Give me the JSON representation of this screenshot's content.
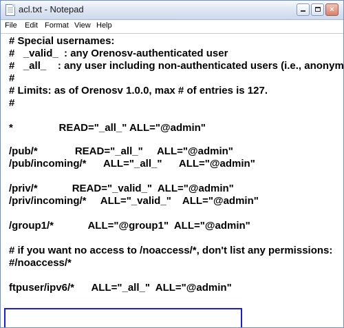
{
  "window": {
    "title": "acl.txt - Notepad",
    "min_label": "",
    "max_label": "",
    "close_label": "×"
  },
  "menu": {
    "file": "File",
    "edit": "Edit",
    "format": "Format",
    "view": "View",
    "help": "Help"
  },
  "editor": {
    "lines": [
      "# Special usernames:",
      "#   _valid_  : any Orenosv-authenticated user",
      "#   _all_    : any user including non-authenticated users (i.e., anonymous)",
      "#",
      "# Limits: as of Orenosv 1.0.0, max # of entries is 127.",
      "#",
      "",
      "*                READ=\"_all_\" ALL=\"@admin\"",
      "",
      "/pub/*             READ=\"_all_\"     ALL=\"@admin\"",
      "/pub/incoming/*      ALL=\"_all_\"      ALL=\"@admin\"",
      "",
      "/priv/*            READ=\"_valid_\"  ALL=\"@admin\"",
      "/priv/incoming/*     ALL=\"_valid_\"    ALL=\"@admin\"",
      "",
      "/group1/*            ALL=\"@group1\"  ALL=\"@admin\"",
      "",
      "# if you want no access to /noaccess/*, don't list any permissions:",
      "#/noaccess/*",
      "",
      "ftpuser/ipv6/*      ALL=\"_all_\"  ALL=\"@admin\""
    ]
  }
}
